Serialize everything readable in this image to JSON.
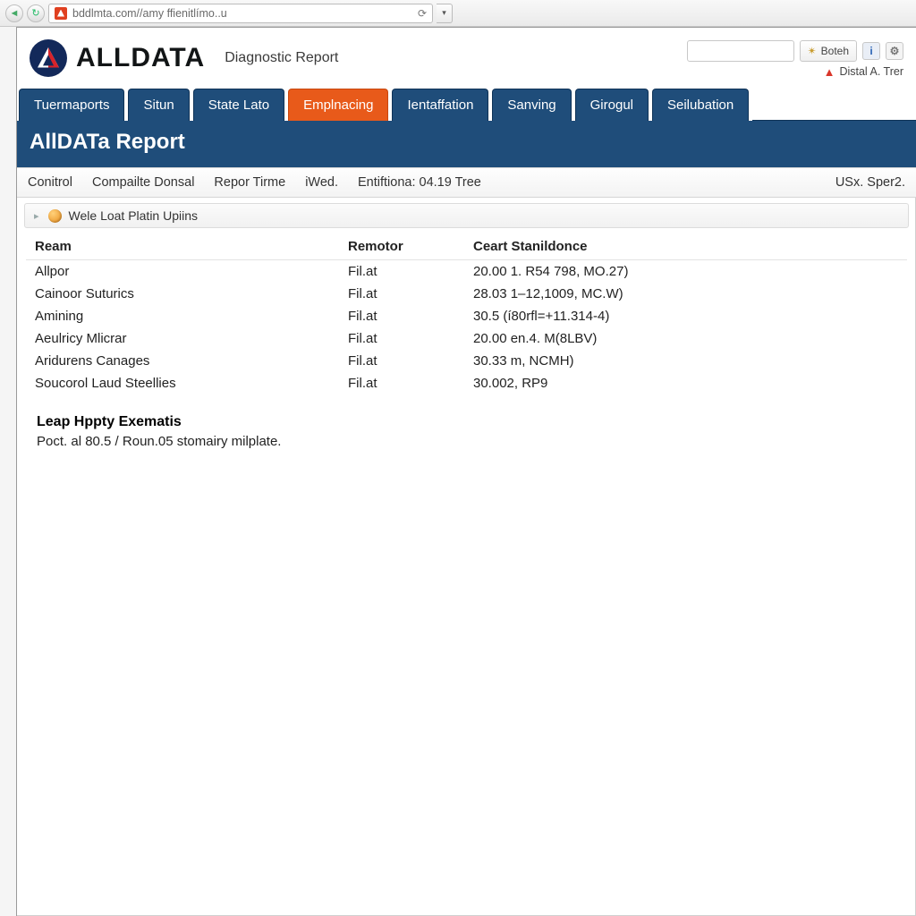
{
  "browser": {
    "url": "bddlmta.com//amy ffienitlímo..u",
    "reload_glyph": "⟳",
    "dropdown_glyph": "▾"
  },
  "header": {
    "brand": "ALLDATA",
    "subtitle": "Diagnostic Report",
    "pill_label": "Boteh",
    "info_glyph": "i",
    "gear_glyph": "⚙",
    "warn_text": "Distal A. Trer"
  },
  "tabs": [
    {
      "label": "Tuermaports",
      "active": false
    },
    {
      "label": "Situn",
      "active": false
    },
    {
      "label": "State Lato",
      "active": false
    },
    {
      "label": "Emplnacing",
      "active": true
    },
    {
      "label": "Ientaffation",
      "active": false
    },
    {
      "label": "Sanving",
      "active": false
    },
    {
      "label": "Girogul",
      "active": false
    },
    {
      "label": "Seilubation",
      "active": false
    }
  ],
  "page_title": "AllDATa Report",
  "secbar": {
    "items": [
      "Conitrol",
      "Compailte Donsal",
      "Repor Tirme",
      "iWed.",
      "Entiftiona: 04.19  Tree"
    ],
    "right": "USx. Sper2."
  },
  "info_strip": "Wele Loat Platin Upiins",
  "table": {
    "columns": [
      "Ream",
      "Remotor",
      "Ceart Stanildonce"
    ],
    "rows": [
      {
        "c0": "Allpor",
        "c1": "Fil.at",
        "c2": "20.00 1. R54 798, MO.27)"
      },
      {
        "c0": "Cainoor Suturics",
        "c1": "Fil.at",
        "c2": "28.03 1–12,1009, MC.W)"
      },
      {
        "c0": "Amining",
        "c1": "Fil.at",
        "c2": "30.5 (í80rfl=+11.314-4)"
      },
      {
        "c0": "Aeulricy Mlicrar",
        "c1": "Fil.at",
        "c2": "20.00 en.4. M(8LBV)"
      },
      {
        "c0": "Aridurens Canages",
        "c1": "Fil.at",
        "c2": "30.33 m, NCMH)"
      },
      {
        "c0": "Soucorol Laud Steellies",
        "c1": "Fil.at",
        "c2": "30.002, RP9"
      }
    ]
  },
  "section": {
    "title": "Leap Hppty Exematis",
    "body": "Poct. al 80.5 / Roun.05 stomairy milplate."
  }
}
